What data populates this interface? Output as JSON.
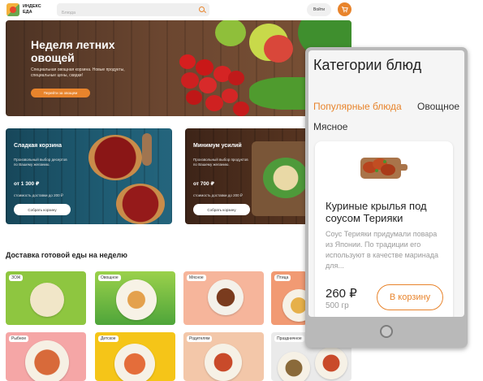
{
  "header": {
    "logo_text": "ИНДЕКС ЕДА",
    "search_placeholder": "Блюда",
    "login_label": "Войти",
    "cart_icon": "cart-icon",
    "search_icon": "search-icon"
  },
  "hero": {
    "title": "Неделя летних овощей",
    "subtitle": "Специальная овощная корзина. Новые продукты, специальные цены, скидки!",
    "button_label": "Перейти за овощем"
  },
  "promos": [
    {
      "title": "Сладкая корзина",
      "description": "Произвольный выбор десертов по Вашему желанию.",
      "price": "от 1 300 ₽",
      "note": "стоимость доставки до 200 ₽",
      "button_label": "Собрать корзину"
    },
    {
      "title": "Минимум усилий",
      "description": "Произвольный выбор продуктов по Вашему желанию.",
      "price": "от 700 ₽",
      "note": "стоимость доставки до 200 ₽",
      "button_label": "Собрать корзину"
    }
  ],
  "section": {
    "title": "Доставка готовой еды на неделю",
    "categories": [
      "ЗОЖ",
      "Овощное",
      "Мясное",
      "Птица",
      "Рыбное",
      "Детское",
      "Родителям",
      "Праздничное"
    ]
  },
  "mobile": {
    "title": "Категории блюд",
    "tabs": [
      "Популярные блюда",
      "Овощное",
      "Мясное"
    ],
    "active_tab": "Популярные блюда",
    "card": {
      "name": "Куриные крылья под соусом Терияки",
      "description": "Соус Терияки придумали повара из Японии. По традиции его используют в качестве маринада для...",
      "price": "260 ₽",
      "weight": "500 гр",
      "button_label": "В корзину"
    }
  },
  "colors": {
    "accent": "#e8842c",
    "tile_backgrounds": [
      "#8ec640",
      "#63b93c",
      "#f6b59b",
      "#f19a73",
      "#f5a6a6",
      "#f5c518",
      "#f3c7a9",
      "#eaeaea"
    ]
  }
}
